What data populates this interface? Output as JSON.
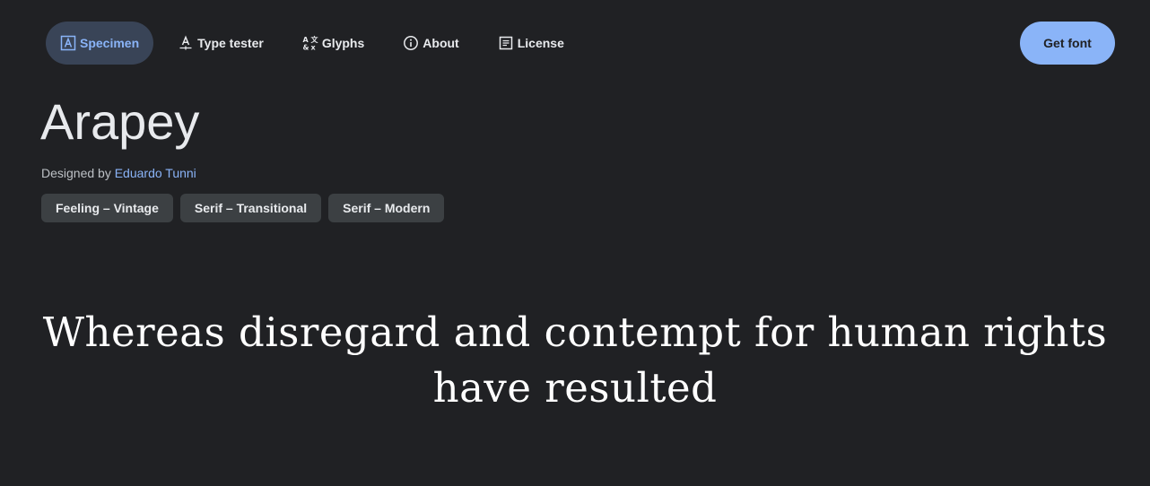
{
  "nav": {
    "tabs": [
      {
        "label": "Specimen",
        "icon": "specimen-icon",
        "active": true
      },
      {
        "label": "Type tester",
        "icon": "type-tester-icon",
        "active": false
      },
      {
        "label": "Glyphs",
        "icon": "glyphs-icon",
        "active": false
      },
      {
        "label": "About",
        "icon": "info-icon",
        "active": false
      },
      {
        "label": "License",
        "icon": "license-icon",
        "active": false
      }
    ],
    "get_font_label": "Get font"
  },
  "font": {
    "name": "Arapey",
    "designed_by_label": "Designed by",
    "designer": "Eduardo Tunni",
    "tags": [
      "Feeling – Vintage",
      "Serif – Transitional",
      "Serif – Modern"
    ]
  },
  "specimen": {
    "line1": "Whereas disregard and contempt for human rights",
    "line2": "have resulted"
  },
  "colors": {
    "background": "#202124",
    "accent": "#8ab4f8",
    "active_tab_bg": "#394457",
    "tag_bg": "#3c4043"
  }
}
